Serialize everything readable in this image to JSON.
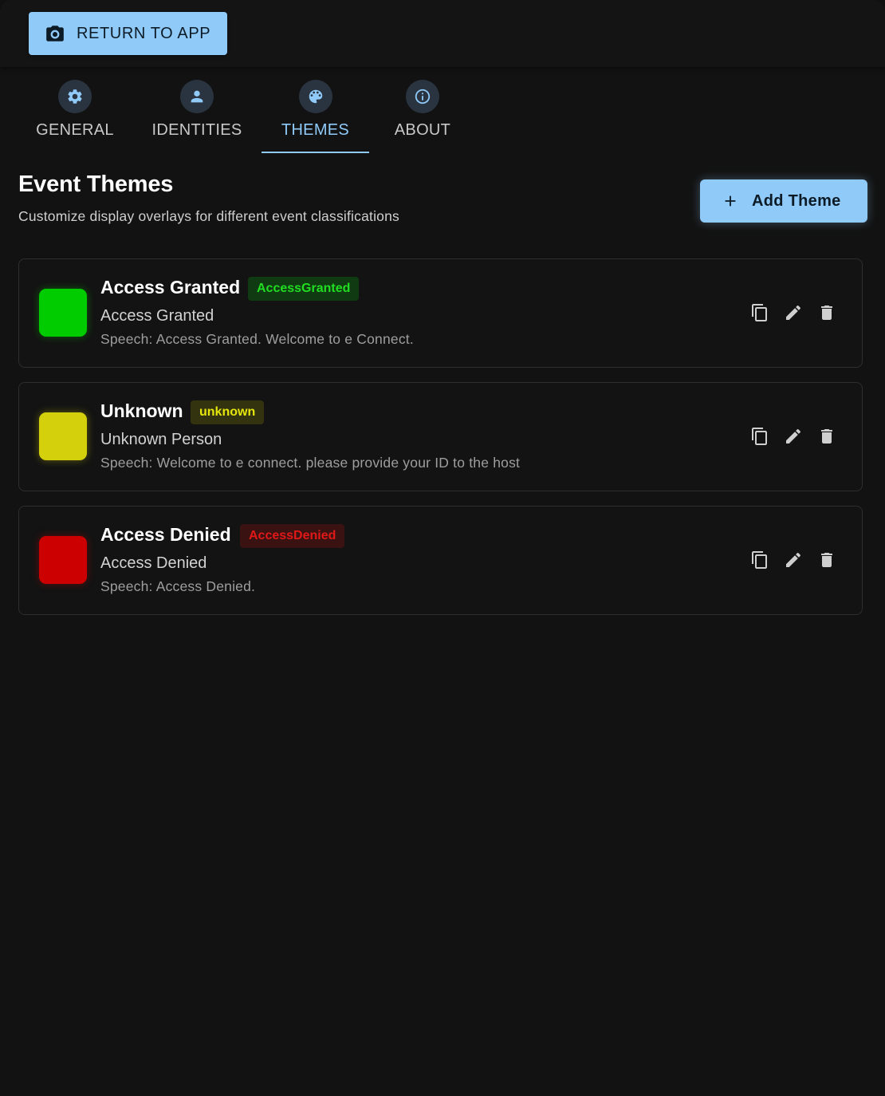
{
  "topbar": {
    "return_label": "RETURN TO APP"
  },
  "tabs": [
    {
      "label": "GENERAL",
      "icon": "gear-icon"
    },
    {
      "label": "IDENTITIES",
      "icon": "person-icon"
    },
    {
      "label": "THEMES",
      "icon": "palette-icon",
      "active": true
    },
    {
      "label": "ABOUT",
      "icon": "info-icon"
    }
  ],
  "section": {
    "title": "Event Themes",
    "subtitle": "Customize display overlays for different event classifications",
    "add_label": "Add Theme"
  },
  "themes": [
    {
      "name": "Access Granted",
      "key": "AccessGranted",
      "overlay": "Access Granted",
      "speech": "Speech: Access Granted. Welcome to e Connect.",
      "color": "#00cc00",
      "badge_bg": "#0f3a12",
      "badge_fg": "#22dd22"
    },
    {
      "name": "Unknown",
      "key": "unknown",
      "overlay": "Unknown Person",
      "speech": "Speech: Welcome to e connect. please provide your ID to the host",
      "color": "#d4d00c",
      "badge_bg": "#34330f",
      "badge_fg": "#e6e60f"
    },
    {
      "name": "Access Denied",
      "key": "AccessDenied",
      "overlay": "Access Denied",
      "speech": "Speech: Access Denied.",
      "color": "#cc0000",
      "badge_bg": "#3a1212",
      "badge_fg": "#e01818"
    }
  ],
  "colors": {
    "accent": "#90caf9",
    "background": "#121212"
  }
}
